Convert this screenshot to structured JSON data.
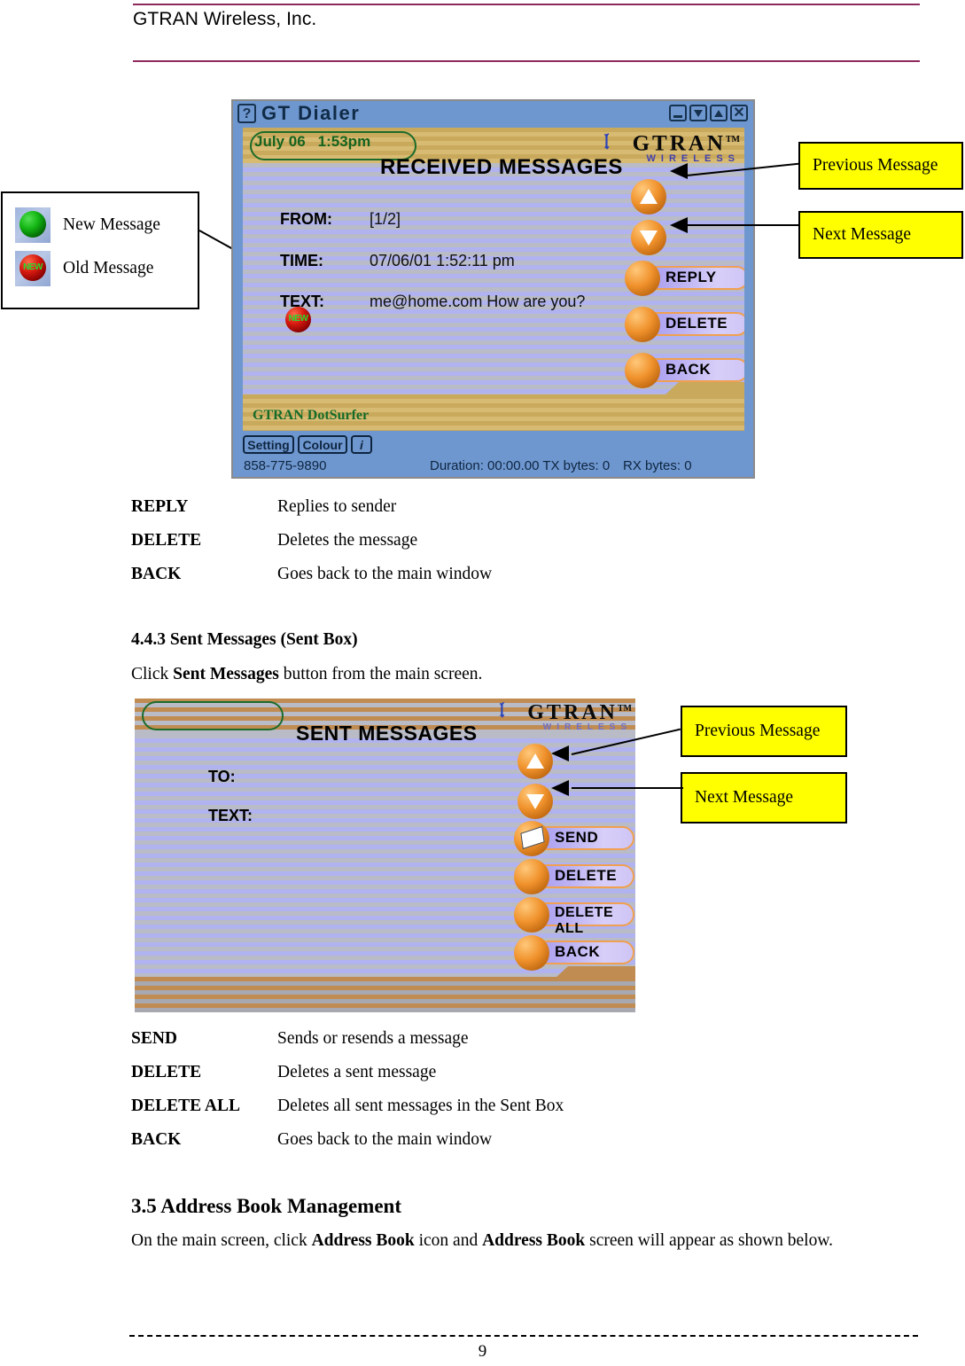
{
  "header": {
    "company": "GTRAN Wireless, Inc.",
    "rule_color": "#8e2a5e"
  },
  "legend": {
    "new_message_label": "New Message",
    "old_message_label": "Old Message",
    "new_ball_text": "",
    "old_ball_text": "NEW"
  },
  "callouts": {
    "previous_message": "Previous Message",
    "next_message": "Next Message"
  },
  "gt_dialer": {
    "window_title": "GT Dialer",
    "help_glyph": "?",
    "title_buttons": [
      "minimize",
      "restore-down",
      "maximize",
      "close"
    ],
    "close_glyph": "✕",
    "date_text": "July 06",
    "time_text": "1:53pm",
    "heading": "RECEIVED MESSAGES",
    "brand_main": "TRAN",
    "brand_initial": "G",
    "brand_tm": "TM",
    "brand_sub": "WIRELESS",
    "fields": [
      {
        "label": "FROM:",
        "value": "[1/2]"
      },
      {
        "label": "TIME:",
        "value": "07/06/01  1:52:11 pm"
      },
      {
        "label": "TEXT:",
        "value": "me@home.com  How are you?"
      }
    ],
    "new_badge": "NEW",
    "buttons": [
      "REPLY",
      "DELETE",
      "BACK"
    ],
    "footer_brand": "GTRAN DotSurfer",
    "status_buttons": [
      "Setting",
      "Colour",
      "i"
    ],
    "phone_number": "858-775-9890",
    "duration_text": "Duration: 00:00.00  TX bytes: 0",
    "rx_text": "RX bytes: 0"
  },
  "received_table": {
    "rows": [
      {
        "key": "REPLY",
        "desc": "Replies to sender"
      },
      {
        "key": "DELETE",
        "desc": "Deletes the message"
      },
      {
        "key": "BACK",
        "desc": "Goes back to the main window"
      }
    ]
  },
  "section_443": {
    "heading_number": "4.4.3",
    "heading_text": "Sent Messages (Sent Box)",
    "intro_pre": "Click ",
    "intro_bold": "Sent Messages",
    "intro_post": " button from the main screen."
  },
  "sent_screen": {
    "heading": "SENT MESSAGES",
    "brand_initial": "G",
    "brand_main": "TRAN",
    "brand_tm": "TM",
    "brand_sub": "WIRELESS",
    "fields": [
      {
        "label": "TO:",
        "value": ""
      },
      {
        "label": "TEXT:",
        "value": ""
      }
    ],
    "buttons": [
      "SEND",
      "DELETE",
      "DELETE ALL",
      "BACK"
    ]
  },
  "sent_table": {
    "rows": [
      {
        "key": "SEND",
        "desc": "Sends or resends a message"
      },
      {
        "key": "DELETE",
        "desc": "Deletes a sent message"
      },
      {
        "key": "DELETE ALL",
        "desc": "Deletes all sent messages in the Sent Box"
      },
      {
        "key": "BACK",
        "desc": "Goes back to the main window"
      }
    ]
  },
  "section_35": {
    "heading": "3.5 Address Book Management",
    "body_1": "On the main screen, click ",
    "body_bold_1": "Address Book",
    "body_2": " icon and ",
    "body_bold_2": "Address Book",
    "body_3": " screen will appear as shown below."
  },
  "footer": {
    "page_number": "9"
  }
}
